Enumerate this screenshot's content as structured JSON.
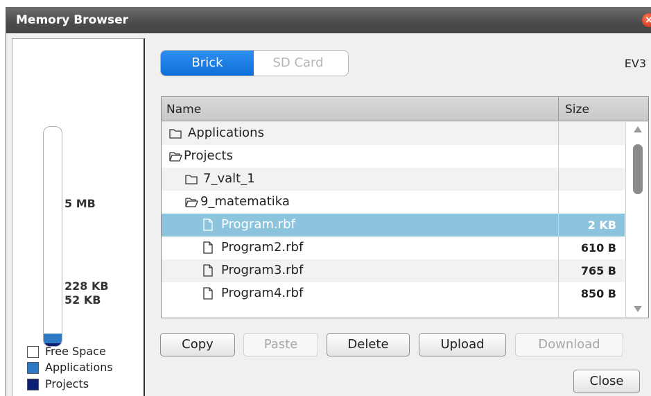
{
  "window": {
    "title": "Memory Browser",
    "close_glyph": "×"
  },
  "storage": {
    "gauge_labels": {
      "top": "5 MB",
      "middle": "228 KB",
      "bottom": "52 KB"
    },
    "legend": [
      {
        "label": "Free Space",
        "color": "#ffffff"
      },
      {
        "label": "Applications",
        "color": "#2e79c3"
      },
      {
        "label": "Projects",
        "color": "#0c1f72"
      }
    ]
  },
  "source_toggle": {
    "active": "Brick",
    "inactive": "SD Card"
  },
  "device_label": "EV3",
  "file_table": {
    "columns": {
      "name": "Name",
      "size": "Size"
    },
    "rows": [
      {
        "name": "Applications",
        "size": "",
        "type": "folder-closed",
        "depth": 0
      },
      {
        "name": "Projects",
        "size": "",
        "type": "folder-open",
        "depth": 0
      },
      {
        "name": "7_valt_1",
        "size": "",
        "type": "folder-closed",
        "depth": 1
      },
      {
        "name": "9_matematika",
        "size": "",
        "type": "folder-open",
        "depth": 1
      },
      {
        "name": "Program.rbf",
        "size": "2 KB",
        "type": "file",
        "depth": 2,
        "selected": true
      },
      {
        "name": "Program2.rbf",
        "size": "610 B",
        "type": "file",
        "depth": 2
      },
      {
        "name": "Program3.rbf",
        "size": "765 B",
        "type": "file",
        "depth": 2
      },
      {
        "name": "Program4.rbf",
        "size": "850 B",
        "type": "file",
        "depth": 2
      }
    ]
  },
  "actions": {
    "copy": "Copy",
    "paste": "Paste",
    "delete": "Delete",
    "upload": "Upload",
    "download": "Download",
    "close": "Close"
  },
  "colors": {
    "accent": "#0d6fd8",
    "selection": "#8cc4de"
  }
}
